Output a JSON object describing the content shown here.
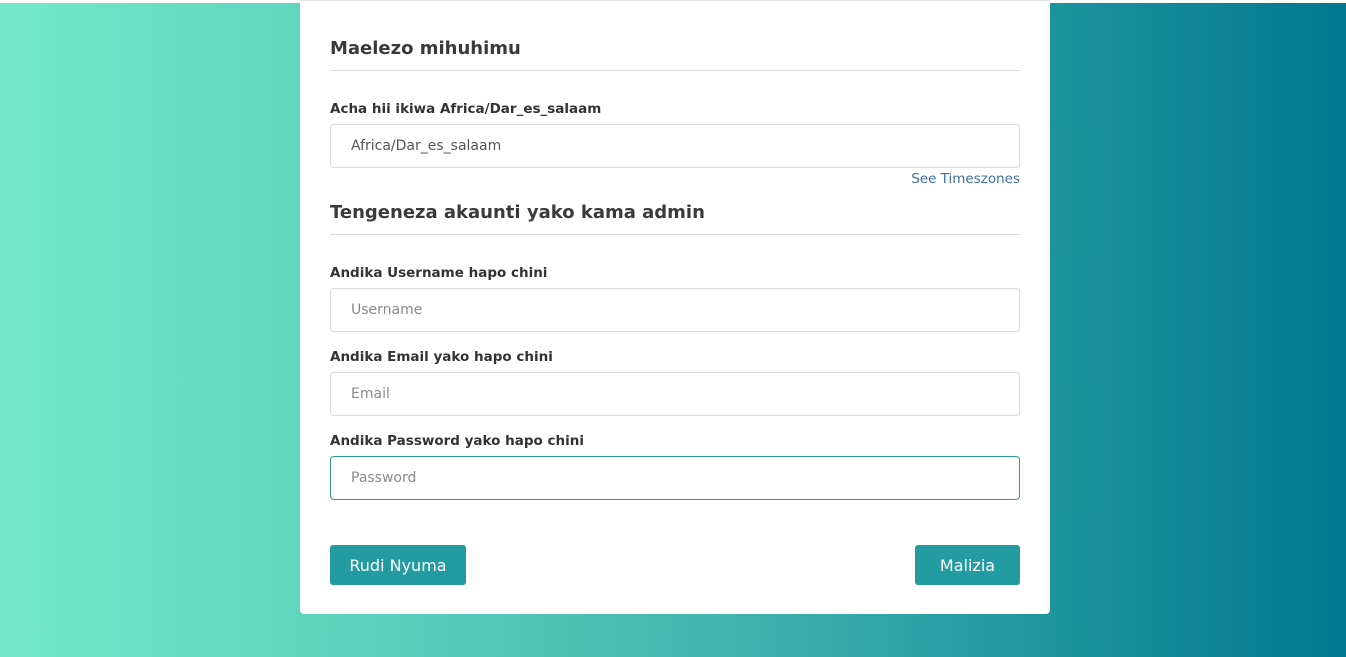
{
  "section1": {
    "title": "Maelezo mihuhimu"
  },
  "timezone": {
    "label": "Acha hii ikiwa Africa/Dar_es_salaam",
    "value": "Africa/Dar_es_salaam",
    "link": "See Timeszones"
  },
  "section2": {
    "title": "Tengeneza akaunti yako kama admin"
  },
  "username": {
    "label": "Andika Username hapo chini",
    "placeholder": "Username"
  },
  "email": {
    "label": "Andika Email yako hapo chini",
    "placeholder": "Email"
  },
  "password": {
    "label": "Andika Password yako hapo chini",
    "placeholder": "Password"
  },
  "buttons": {
    "back": "Rudi Nyuma",
    "finish": "Malizia"
  },
  "colors": {
    "accent": "#229ba1",
    "gradient_start": "#74e8c6",
    "gradient_end": "#02788f",
    "link": "#3d6fa8"
  }
}
